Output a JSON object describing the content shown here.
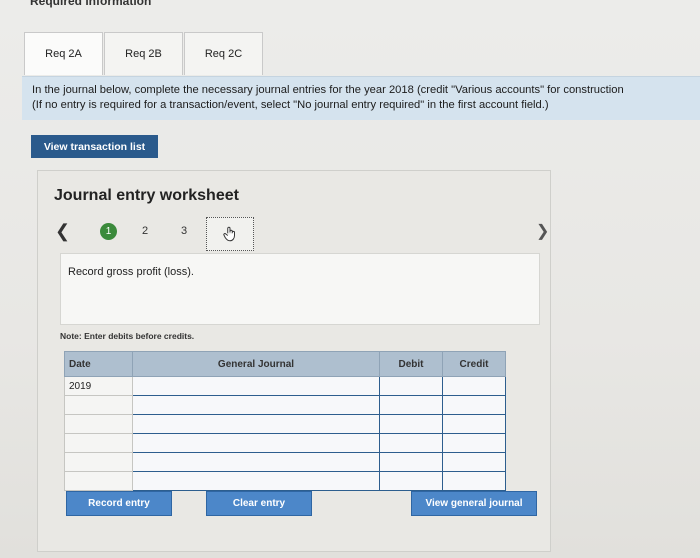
{
  "header": {
    "title": "Required information"
  },
  "tabs": [
    {
      "label": "Req 2A"
    },
    {
      "label": "Req 2B"
    },
    {
      "label": "Req 2C"
    }
  ],
  "instructions": {
    "line1": "In the journal below, complete the necessary journal entries for the year 2018 (credit \"Various accounts\" for construction",
    "line2": "(If no entry is required for a transaction/event, select \"No journal entry required\" in the first account field.)"
  },
  "buttons": {
    "view_transactions": "View transaction list",
    "record_entry": "Record entry",
    "clear_entry": "Clear entry",
    "view_general_journal": "View general journal"
  },
  "worksheet": {
    "title": "Journal entry worksheet",
    "steps": [
      "1",
      "2",
      "3"
    ],
    "description": "Record gross profit (loss).",
    "note_label": "Note:",
    "note_text": "Enter debits before credits."
  },
  "table": {
    "headers": {
      "date": "Date",
      "general_journal": "General Journal",
      "debit": "Debit",
      "credit": "Credit"
    },
    "rows": [
      {
        "date": "2019",
        "account": "",
        "debit": "",
        "credit": ""
      },
      {
        "date": "",
        "account": "",
        "debit": "",
        "credit": ""
      },
      {
        "date": "",
        "account": "",
        "debit": "",
        "credit": ""
      },
      {
        "date": "",
        "account": "",
        "debit": "",
        "credit": ""
      },
      {
        "date": "",
        "account": "",
        "debit": "",
        "credit": ""
      },
      {
        "date": "",
        "account": "",
        "debit": "",
        "credit": ""
      }
    ]
  },
  "colors": {
    "accent": "#2a5a8c",
    "button": "#4c87c9",
    "step_active": "#3b8a3b",
    "instruction_bg": "#d5e3ee",
    "table_header": "#aebfcf"
  },
  "icons": {
    "nav_prev": "chevron-left-icon",
    "nav_next": "chevron-right-icon",
    "cursor": "hand-pointer-icon"
  }
}
